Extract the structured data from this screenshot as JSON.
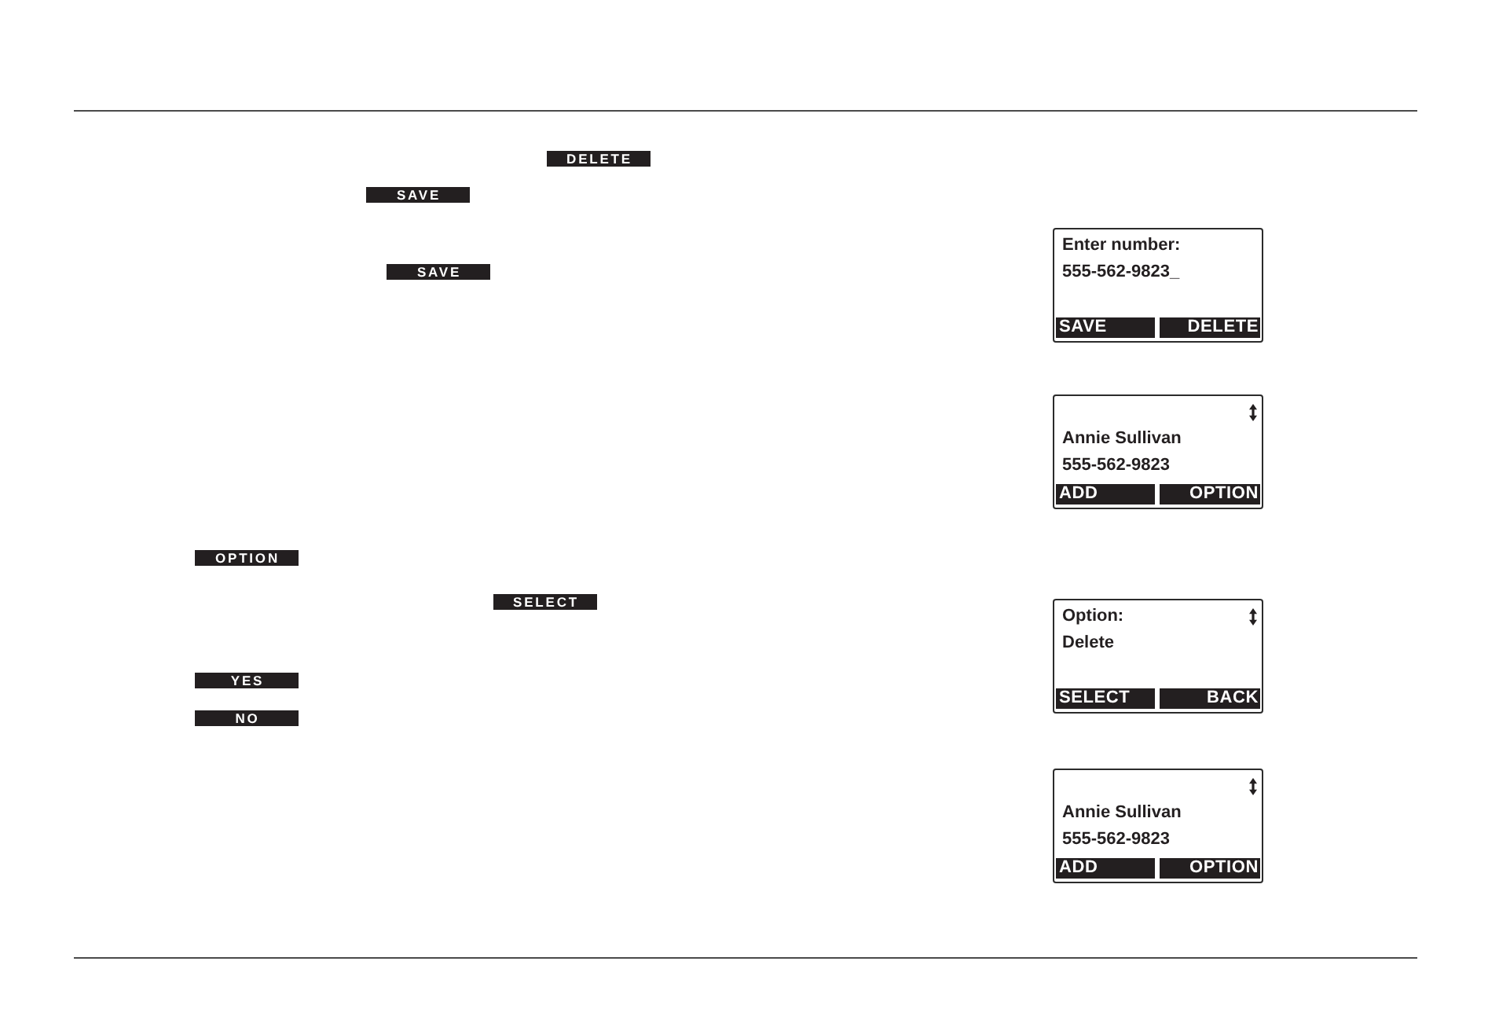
{
  "text_soft_keys": [
    "DELETE",
    "SAVE",
    "SAVE",
    "OPTION",
    "SELECT",
    "YES",
    "NO"
  ],
  "screens": [
    {
      "heading": "Enter number:",
      "lines": [
        "555-562-9823_"
      ],
      "scroll_icon": false,
      "soft_keys": [
        "SAVE",
        "DELETE"
      ]
    },
    {
      "lines": [
        "Annie Sullivan",
        "555-562-9823"
      ],
      "scroll_icon": true,
      "soft_keys": [
        "ADD",
        "OPTION"
      ]
    },
    {
      "heading": "Option:",
      "lines": [
        "Delete"
      ],
      "scroll_icon": true,
      "soft_keys": [
        "SELECT",
        "BACK"
      ]
    },
    {
      "lines": [
        "Annie Sullivan",
        "555-562-9823"
      ],
      "scroll_icon": true,
      "soft_keys": [
        "ADD",
        "OPTION"
      ]
    }
  ]
}
